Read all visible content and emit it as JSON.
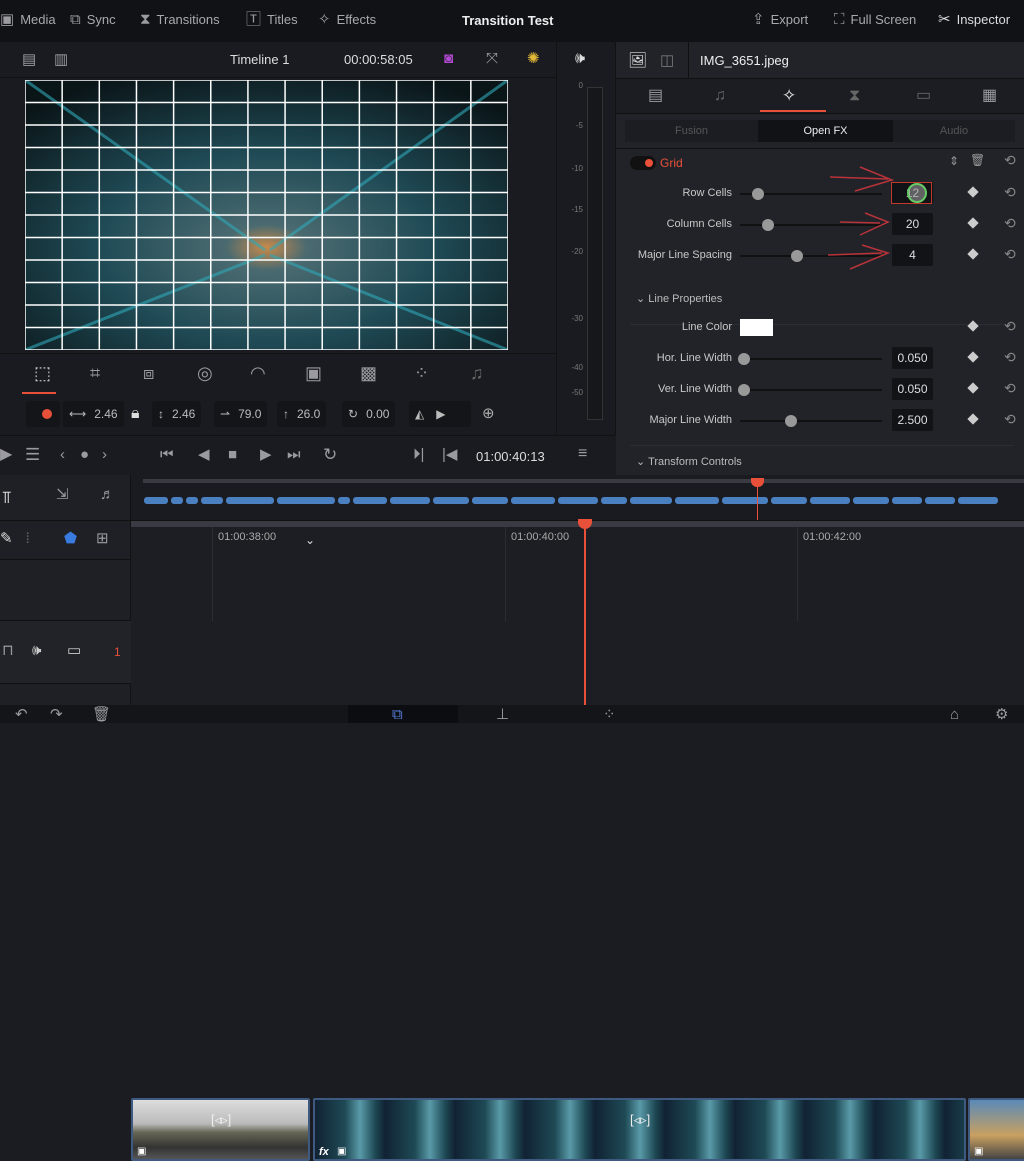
{
  "topbar": {
    "items": [
      {
        "label": "Media",
        "icon": "media-icon"
      },
      {
        "label": "Sync",
        "icon": "sync-icon"
      },
      {
        "label": "Transitions",
        "icon": "transitions-icon"
      },
      {
        "label": "Titles",
        "icon": "titles-icon"
      },
      {
        "label": "Effects",
        "icon": "effects-wand-icon"
      }
    ],
    "project_title": "Transition Test",
    "export": "Export",
    "fullscreen": "Full Screen",
    "inspector": "Inspector"
  },
  "viewer": {
    "timeline_name": "Timeline 1",
    "duration_timecode": "00:00:58:05",
    "grid_rows": 12,
    "grid_columns": 20
  },
  "transform": {
    "zoom_x": "2.46",
    "zoom_y": "2.46",
    "position_x": "79.0",
    "position_y": "26.0",
    "rotation": "0.00"
  },
  "transport": {
    "timecode": "01:00:40:13"
  },
  "meter": {
    "ticks": [
      "0",
      "-5",
      "-10",
      "-15",
      "-20",
      "-30",
      "-40",
      "-50"
    ]
  },
  "inspector": {
    "clip_name": "IMG_3651.jpeg",
    "subtabs": [
      "Fusion",
      "Open FX",
      "Audio"
    ],
    "active_subtab": "Open FX",
    "effect_name": "Grid",
    "accent_color": "#e8503a",
    "params": [
      {
        "label": "Row Cells",
        "value": "12",
        "slider": 0.13
      },
      {
        "label": "Column Cells",
        "value": "20",
        "slider": 0.2
      },
      {
        "label": "Major Line Spacing",
        "value": "4",
        "slider": 0.4
      }
    ],
    "line_properties": {
      "header": "Line Properties",
      "line_color_label": "Line Color",
      "line_color": "#ffffff",
      "params": [
        {
          "label": "Hor. Line Width",
          "value": "0.050",
          "slider": 0.03
        },
        {
          "label": "Ver. Line Width",
          "value": "0.050",
          "slider": 0.03
        },
        {
          "label": "Major Line Width",
          "value": "2.500",
          "slider": 0.36
        }
      ]
    },
    "transform_header": "Transform Controls"
  },
  "timeline": {
    "ruler": [
      "01:00:38:00",
      "01:00:40:00",
      "01:00:42:00"
    ],
    "track_number": "1",
    "clip_fx_label": "fx"
  }
}
